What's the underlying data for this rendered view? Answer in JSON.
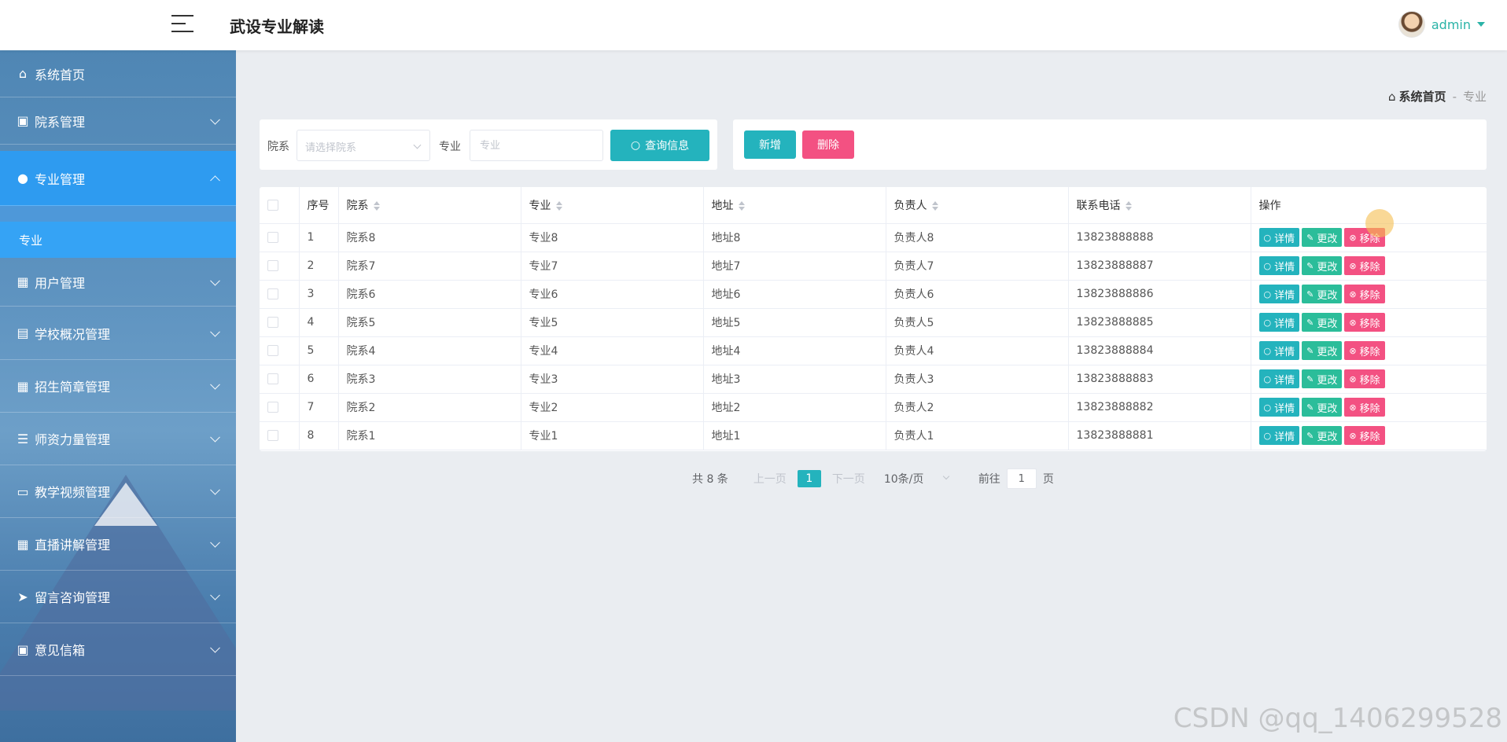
{
  "header": {
    "title": "武设专业解读",
    "user": "admin"
  },
  "sidebar": {
    "items": [
      {
        "label": "系统首页",
        "icon": "home-icon"
      },
      {
        "label": "院系管理",
        "icon": "clipboard-icon"
      },
      {
        "label": "专业管理",
        "icon": "user-icon"
      },
      {
        "label": "用户管理",
        "icon": "grid-icon"
      },
      {
        "label": "学校概况管理",
        "icon": "briefcase-icon"
      },
      {
        "label": "招生简章管理",
        "icon": "grid-icon"
      },
      {
        "label": "师资力量管理",
        "icon": "list-icon"
      },
      {
        "label": "教学视频管理",
        "icon": "monitor-icon"
      },
      {
        "label": "直播讲解管理",
        "icon": "grid-icon"
      },
      {
        "label": "留言咨询管理",
        "icon": "send-icon"
      },
      {
        "label": "意见信箱",
        "icon": "clipboard-icon"
      }
    ],
    "sub_item": "专业"
  },
  "breadcrumb": {
    "home": "系统首页",
    "separator": "-",
    "current": "专业"
  },
  "search": {
    "dept_label": "院系",
    "dept_placeholder": "请选择院系",
    "major_label": "专业",
    "major_placeholder": "专业",
    "query_button": "查询信息"
  },
  "actions": {
    "add": "新增",
    "delete": "删除"
  },
  "table": {
    "headers": [
      "序号",
      "院系",
      "专业",
      "地址",
      "负责人",
      "联系电话",
      "操作"
    ],
    "rows": [
      [
        "1",
        "院系8",
        "专业8",
        "地址8",
        "负责人8",
        "13823888888"
      ],
      [
        "2",
        "院系7",
        "专业7",
        "地址7",
        "负责人7",
        "13823888887"
      ],
      [
        "3",
        "院系6",
        "专业6",
        "地址6",
        "负责人6",
        "13823888886"
      ],
      [
        "4",
        "院系5",
        "专业5",
        "地址5",
        "负责人5",
        "13823888885"
      ],
      [
        "5",
        "院系4",
        "专业4",
        "地址4",
        "负责人4",
        "13823888884"
      ],
      [
        "6",
        "院系3",
        "专业3",
        "地址3",
        "负责人3",
        "13823888883"
      ],
      [
        "7",
        "院系2",
        "专业2",
        "地址2",
        "负责人2",
        "13823888882"
      ],
      [
        "8",
        "院系1",
        "专业1",
        "地址1",
        "负责人1",
        "13823888881"
      ]
    ],
    "row_actions": {
      "detail": "详情",
      "edit": "更改",
      "remove": "移除"
    }
  },
  "pagination": {
    "total": "共 8 条",
    "prev": "上一页",
    "current_page": "1",
    "next": "下一页",
    "page_size": "10条/页",
    "goto_prefix": "前往",
    "goto_value": "1",
    "goto_suffix": "页"
  },
  "watermark": "CSDN @qq_1406299528",
  "colors": {
    "accent": "#24b3bd",
    "danger": "#f35182",
    "edit": "#2bbd9a",
    "sidebar_active": "#2e9bf0"
  }
}
